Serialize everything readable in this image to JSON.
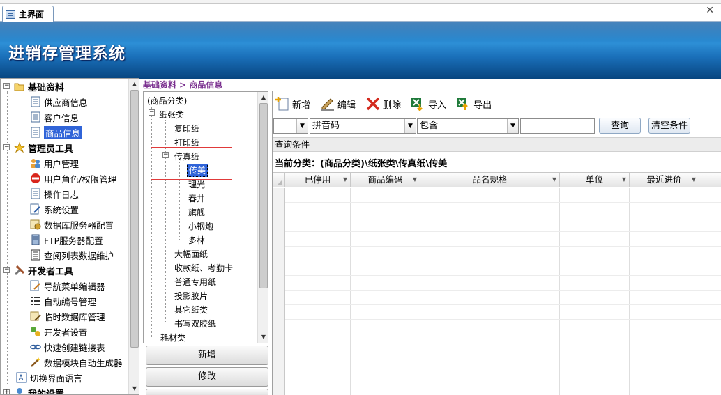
{
  "window": {
    "tab_label": "主界面",
    "close_glyph": "✕"
  },
  "banner": {
    "title": "进销存管理系统"
  },
  "nav": {
    "groups": [
      {
        "label": "基础资料",
        "items": [
          "供应商信息",
          "客户信息",
          "商品信息"
        ]
      },
      {
        "label": "管理员工具",
        "items": [
          "用户管理",
          "用户角色/权限管理",
          "操作日志",
          "系统设置",
          "数据库服务器配置",
          "FTP服务器配置",
          "查阅列表数据维护"
        ]
      },
      {
        "label": "开发者工具",
        "items": [
          "导航菜单编辑器",
          "自动编号管理",
          "临时数据库管理",
          "开发者设置",
          "快速创建链接表",
          "数据模块自动生成器"
        ]
      }
    ],
    "extra_item": "切换界面语言",
    "last_group": "我的设置",
    "selected": "商品信息"
  },
  "breadcrumb": "基础资料 > 商品信息",
  "categories": {
    "root": "(商品分类)",
    "paper": "纸张类",
    "fax_paper": "传真纸",
    "fax_children": [
      "传美",
      "理光",
      "春井",
      "旗舰",
      "小钢炮",
      "多林"
    ],
    "paper_others": [
      "复印纸",
      "打印纸",
      "大幅面纸",
      "收款纸、考勤卡",
      "普通专用纸",
      "投影胶片",
      "其它纸类",
      "书写双胶纸"
    ],
    "consumables": "耗材类",
    "selected": "传美"
  },
  "cat_buttons": {
    "add": "新增",
    "edit": "修改"
  },
  "toolbar": {
    "add": "新增",
    "edit": "编辑",
    "delete": "删除",
    "import": "导入",
    "export": "导出"
  },
  "search": {
    "field1": "",
    "field2": "拼音码",
    "field3": "包含",
    "value": "",
    "query_btn": "查询",
    "clear_btn": "清空条件"
  },
  "condition_label": "查询条件",
  "current_category": "当前分类：(商品分类)\\纸张类\\传真纸\\传美",
  "grid": {
    "columns": [
      "已停用",
      "商品编码",
      "品名规格",
      "单位",
      "最近进价"
    ]
  }
}
